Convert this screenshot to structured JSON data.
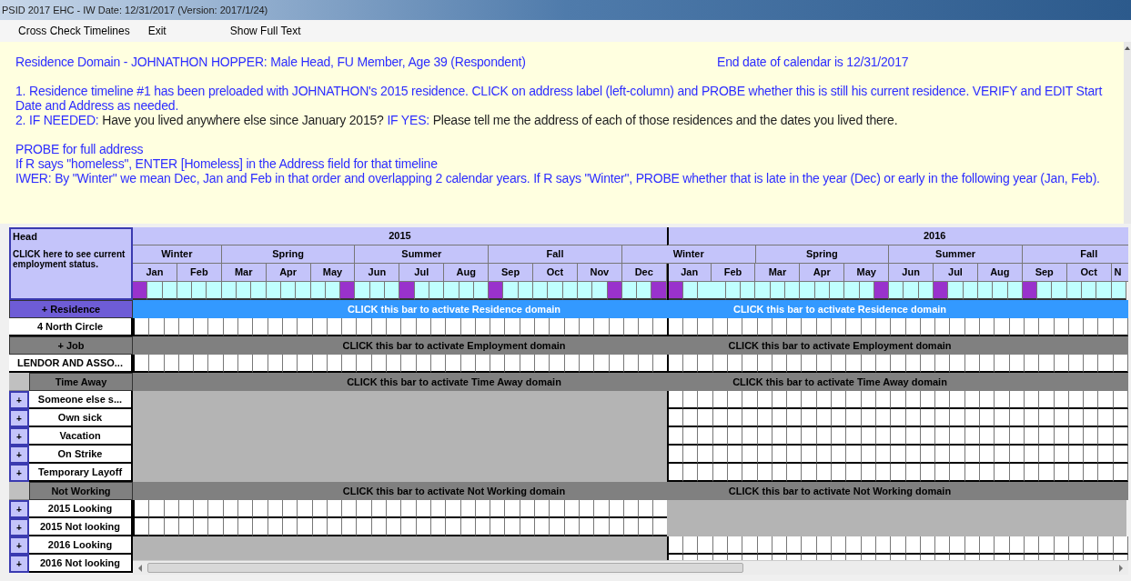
{
  "window": {
    "title": "PSID 2017 EHC - IW Date: 12/31/2017 (Version: 2017/1/24)"
  },
  "menu": [
    {
      "label": "Cross Check Timelines"
    },
    {
      "label": "Exit"
    },
    {
      "label": "Show Full Text"
    }
  ],
  "instructions": {
    "heading": "Residence Domain - JOHNATHON HOPPER: Male Head, FU Member, Age 39 (Respondent)",
    "end_date": "End date of calendar is 12/31/2017",
    "blocks": [
      [
        {
          "segments": [
            {
              "kind": "instruction",
              "text": "1. Residence timeline #1 has been preloaded with JOHNATHON's 2015 residence. CLICK on address label (left-column) and PROBE whether this is still his current residence. VERIFY and EDIT Start Date and Address as needed."
            }
          ]
        },
        {
          "segments": [
            {
              "kind": "instruction",
              "text": "2. IF NEEDED:"
            },
            {
              "kind": "question",
              "text": "Have you lived anywhere else since January 2015?"
            },
            {
              "kind": "instruction",
              "text": "IF YES:"
            },
            {
              "kind": "question",
              "text": "Please tell me the address of each of those residences and the dates you lived there."
            }
          ]
        }
      ],
      [
        {
          "segments": [
            {
              "kind": "instruction",
              "text": "PROBE for full address"
            }
          ]
        },
        {
          "segments": [
            {
              "kind": "instruction",
              "text": "If R says \"homeless\", ENTER [Homeless] in the Address field for that timeline"
            }
          ]
        },
        {
          "segments": [
            {
              "kind": "instruction",
              "text": "IWER: By \"Winter\" we mean Dec, Jan and Feb in that order and overlapping 2 calendar years. If R says \"Winter\", PROBE whether that is late in the year (Dec) or early in the following year (Jan, Feb)."
            }
          ]
        }
      ]
    ]
  },
  "calendar": {
    "corner": {
      "title": "Head",
      "note": "CLICK here to see current employment status."
    },
    "years": [
      {
        "label": "2015"
      },
      {
        "label": "2016"
      }
    ],
    "seasons": [
      {
        "label": "Winter",
        "months": [
          {
            "label": "Jan",
            "marked": [
              true,
              false,
              false
            ]
          },
          {
            "label": "Feb",
            "marked": [
              false,
              false,
              false
            ]
          }
        ]
      },
      {
        "label": "Spring",
        "months": [
          {
            "label": "Mar",
            "marked": [
              false,
              false,
              false
            ]
          },
          {
            "label": "Apr",
            "marked": [
              false,
              false,
              false
            ]
          },
          {
            "label": "May",
            "marked": [
              false,
              false,
              true
            ]
          }
        ]
      },
      {
        "label": "Summer",
        "months": [
          {
            "label": "Jun",
            "marked": [
              false,
              false,
              false
            ]
          },
          {
            "label": "Jul",
            "marked": [
              true,
              false,
              false
            ]
          },
          {
            "label": "Aug",
            "marked": [
              false,
              false,
              false
            ]
          }
        ]
      },
      {
        "label": "Fall",
        "months": [
          {
            "label": "Sep",
            "marked": [
              true,
              false,
              false
            ]
          },
          {
            "label": "Oct",
            "marked": [
              false,
              false,
              false
            ]
          },
          {
            "label": "Nov",
            "marked": [
              false,
              false,
              true
            ]
          }
        ]
      },
      {
        "label": "Winter",
        "months": [
          {
            "label": "Dec",
            "marked": [
              false,
              false,
              true
            ]
          },
          {
            "label": "Jan",
            "marked": [
              true,
              false,
              false
            ]
          },
          {
            "label": "Feb",
            "marked": [
              false,
              false,
              false
            ]
          }
        ]
      },
      {
        "label": "Spring",
        "months": [
          {
            "label": "Mar",
            "marked": [
              false,
              false,
              false
            ]
          },
          {
            "label": "Apr",
            "marked": [
              false,
              false,
              false
            ]
          },
          {
            "label": "May",
            "marked": [
              false,
              false,
              true
            ]
          }
        ]
      },
      {
        "label": "Summer",
        "months": [
          {
            "label": "Jun",
            "marked": [
              false,
              false,
              false
            ]
          },
          {
            "label": "Jul",
            "marked": [
              true,
              false,
              false
            ]
          },
          {
            "label": "Aug",
            "marked": [
              false,
              false,
              false
            ]
          }
        ]
      },
      {
        "label": "Fall",
        "months": [
          {
            "label": "Sep",
            "marked": [
              true,
              false,
              false
            ]
          },
          {
            "label": "Oct",
            "marked": [
              false,
              false,
              false
            ]
          },
          {
            "label": "N",
            "cut": true,
            "marked": [
              false
            ]
          }
        ]
      }
    ]
  },
  "domains": [
    {
      "label": "+ Residence",
      "kind": "plain",
      "selected": true,
      "bar_texts": [
        "CLICK this bar to activate Residence domain",
        "CLICK this bar to activate Residence domain"
      ],
      "rows": [
        {
          "label": "4 North Circle",
          "active": [
            true,
            true
          ]
        }
      ]
    },
    {
      "label": "+ Job",
      "kind": "plain",
      "selected": false,
      "bar_texts": [
        "CLICK this bar to activate Employment domain",
        "CLICK this bar to activate Employment domain"
      ],
      "rows": [
        {
          "label": "LENDOR AND ASSO...",
          "active": [
            true,
            true
          ]
        }
      ]
    },
    {
      "label": "Time Away",
      "kind": "category",
      "selected": false,
      "bar_texts": [
        "CLICK this bar to activate Time Away domain",
        "CLICK this bar to activate Time Away domain"
      ],
      "rows": [
        {
          "button": "+",
          "label": "Someone else s...",
          "active": [
            false,
            true
          ]
        },
        {
          "button": "+",
          "label": "Own sick",
          "active": [
            false,
            true
          ]
        },
        {
          "button": "+",
          "label": "Vacation",
          "active": [
            false,
            true
          ]
        },
        {
          "button": "+",
          "label": "On Strike",
          "active": [
            false,
            true
          ]
        },
        {
          "button": "+",
          "label": "Temporary Layoff",
          "active": [
            false,
            true
          ]
        }
      ]
    },
    {
      "label": "Not Working",
      "kind": "category",
      "selected": false,
      "bar_texts": [
        "CLICK this bar to activate Not Working domain",
        "CLICK this bar to activate Not Working domain"
      ],
      "rows": [
        {
          "button": "+",
          "label": "2015 Looking",
          "active": [
            true,
            false
          ]
        },
        {
          "button": "+",
          "label": "2015 Not looking",
          "active": [
            true,
            false
          ]
        },
        {
          "button": "+",
          "label": "2016 Looking",
          "active": [
            false,
            true
          ]
        },
        {
          "button": "+",
          "label": "2016 Not looking",
          "active": [
            false,
            true
          ]
        }
      ]
    }
  ]
}
